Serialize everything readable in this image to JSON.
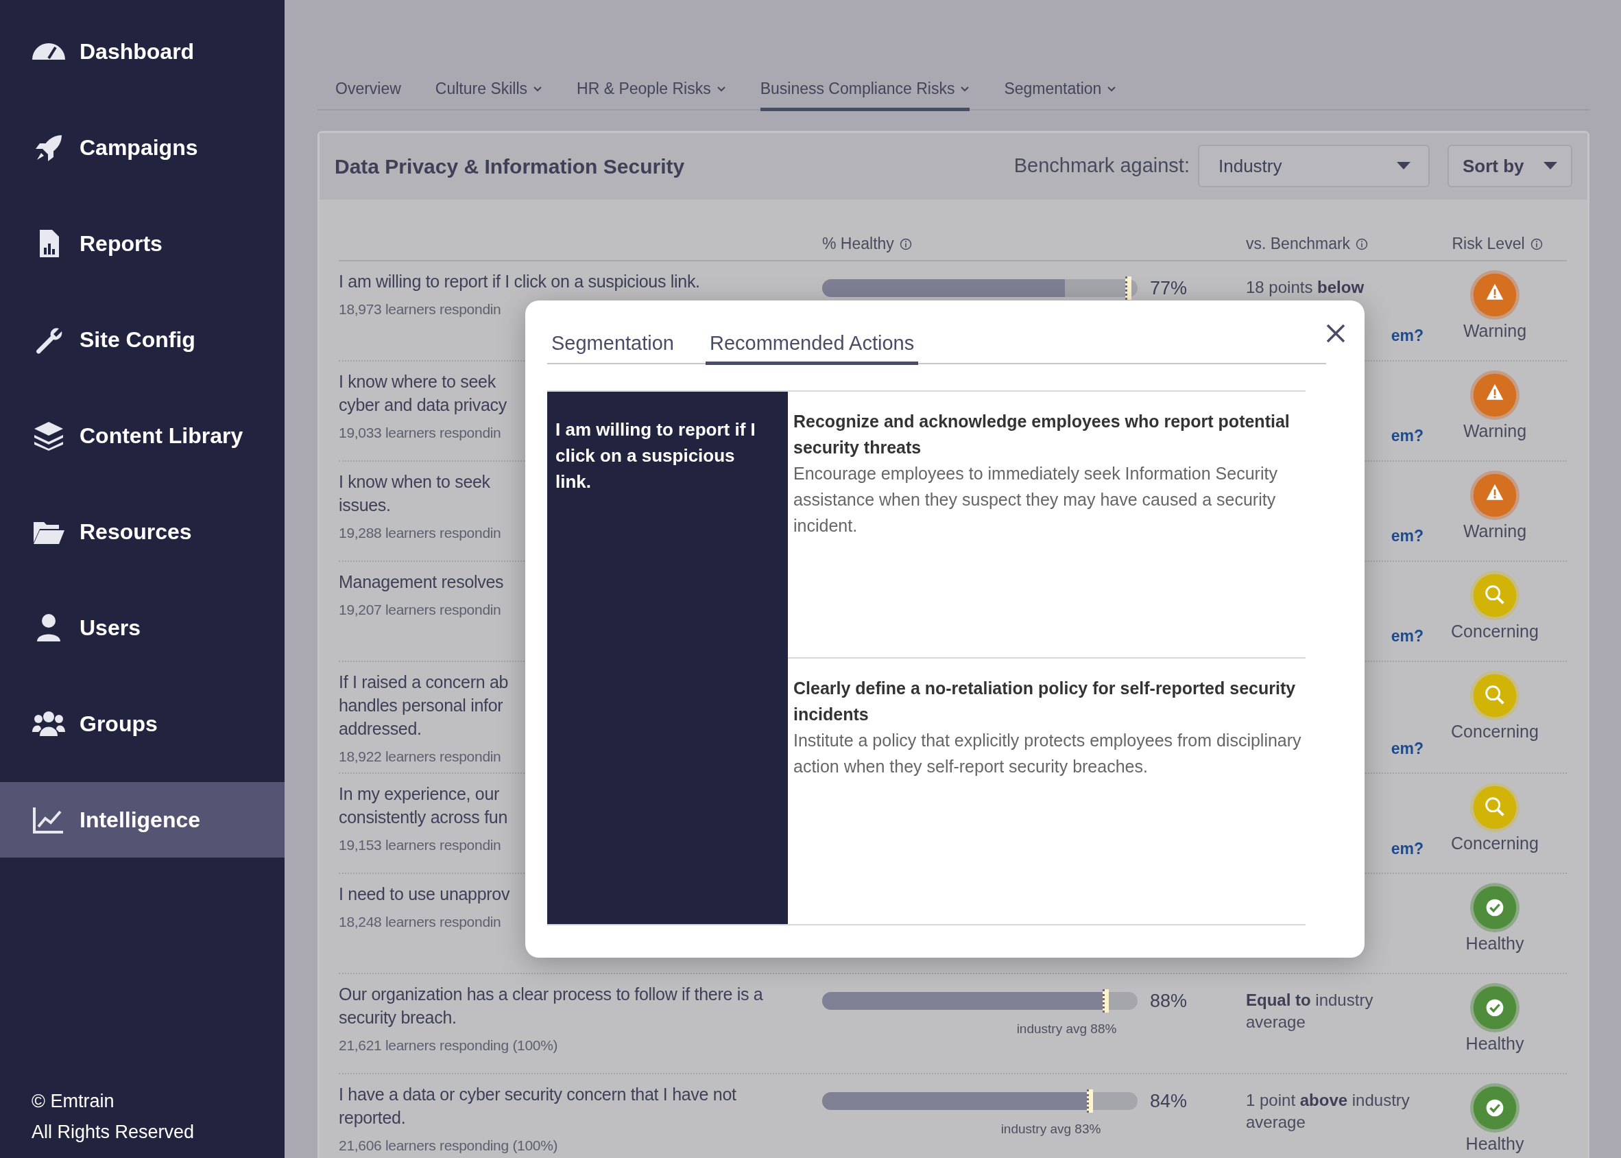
{
  "sidebar": {
    "items": [
      {
        "label": "Dashboard",
        "selected": false
      },
      {
        "label": "Campaigns",
        "selected": false
      },
      {
        "label": "Reports",
        "selected": false
      },
      {
        "label": "Site Config",
        "selected": false
      },
      {
        "label": "Content Library",
        "selected": false
      },
      {
        "label": "Resources",
        "selected": false
      },
      {
        "label": "Users",
        "selected": false
      },
      {
        "label": "Groups",
        "selected": false
      },
      {
        "label": "Intelligence",
        "selected": true
      }
    ],
    "footer": [
      "© Emtrain",
      "All Rights Reserved"
    ]
  },
  "tabs": [
    {
      "label": "Overview",
      "dropdown": false,
      "selected": false
    },
    {
      "label": "Culture Skills",
      "dropdown": true,
      "selected": false
    },
    {
      "label": "HR & People Risks",
      "dropdown": true,
      "selected": false
    },
    {
      "label": "Business Compliance Risks",
      "dropdown": true,
      "selected": true
    },
    {
      "label": "Segmentation",
      "dropdown": true,
      "selected": false
    }
  ],
  "card": {
    "title": "Data Privacy & Information Security",
    "benchmark_label": "Benchmark against:",
    "benchmark_value": "Industry",
    "sort_button": "Sort by",
    "columns": [
      "% Healthy",
      "vs. Benchmark",
      "Risk Level"
    ],
    "rows": [
      {
        "question": [
          "I am willing to report if I click on a suspicious link."
        ],
        "responding": "18,973 learners respondin",
        "bar": {
          "level": 0.77
        },
        "marker": {
          "level": 0.96
        },
        "percent": "77%",
        "benchmark": "18 points **below**",
        "link": "em?",
        "risk": {
          "kind": "warning",
          "label": "Warning"
        }
      },
      {
        "question": [
          "I know where to seek",
          "cyber and data privacy"
        ],
        "responding": "19,033 learners respondin",
        "link": "em?",
        "risk": {
          "kind": "warning",
          "label": "Warning"
        }
      },
      {
        "question": [
          "I know when to seek",
          "issues."
        ],
        "responding": "19,288 learners respondin",
        "link": "em?",
        "risk": {
          "kind": "warning",
          "label": "Warning"
        }
      },
      {
        "question": [
          "Management resolves"
        ],
        "responding": "19,207 learners respondin",
        "link": "em?",
        "risk": {
          "kind": "concerning",
          "label": "Concerning"
        }
      },
      {
        "question": [
          "If I raised a concern ab",
          "handles personal infor",
          "addressed."
        ],
        "responding": "18,922 learners respondin",
        "link": "em?",
        "risk": {
          "kind": "concerning",
          "label": "Concerning"
        }
      },
      {
        "question": [
          "In my experience, our",
          "consistently across fun"
        ],
        "responding": "19,153 learners respondin",
        "link": "em?",
        "risk": {
          "kind": "concerning",
          "label": "Concerning"
        }
      },
      {
        "question": [
          "I need to use unapprov"
        ],
        "responding": "18,248 learners respondin",
        "risk": {
          "kind": "healthy",
          "label": "Healthy"
        }
      },
      {
        "question": [
          "Our organization has a clear process to follow if there is a",
          "security breach."
        ],
        "responding": "21,621 learners responding (100%)",
        "bar": {
          "level": 0.89
        },
        "marker": {
          "level": 0.89
        },
        "avg_label": "industry avg 88%",
        "percent": "88%",
        "benchmark": "**Equal to** industry average",
        "risk": {
          "kind": "healthy",
          "label": "Healthy"
        }
      },
      {
        "question": [
          "I have a data or cyber security concern that I have not",
          "reported."
        ],
        "responding": "21,606 learners responding (100%)",
        "bar": {
          "level": 0.84
        },
        "marker": {
          "level": 0.84
        },
        "avg_label": "industry avg 83%",
        "percent": "84%",
        "benchmark": "1 point **above** industry average",
        "risk": {
          "kind": "healthy",
          "label": "Healthy"
        }
      }
    ]
  },
  "modal": {
    "tabs": [
      {
        "label": "Segmentation",
        "selected": false
      },
      {
        "label": "Recommended Actions",
        "selected": true
      }
    ],
    "statement": "I am willing to report if I click on a suspicious link.",
    "actions": [
      {
        "title": "Recognize and acknowledge employees who report potential security threats",
        "description": "Encourage employees to immediately seek Information Security assistance when they suspect they may have caused a security incident."
      },
      {
        "title": "Clearly define a no-retaliation policy for self-reported security incidents",
        "description": "Institute a policy that explicitly protects employees from disciplinary action when they self-report security breaches."
      }
    ]
  }
}
